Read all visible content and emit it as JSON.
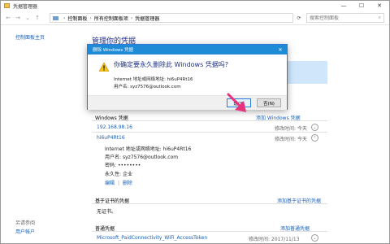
{
  "window": {
    "title": "凭据管理器",
    "controls": {
      "minimize": "—",
      "maximize": "☐",
      "close": "✕"
    }
  },
  "addressbar": {
    "breadcrumb": [
      "控制面板",
      "所有控制面板项",
      "凭据管理器"
    ],
    "search_placeholder": "搜索控制面板"
  },
  "leftnav": {
    "home": "控制面板主页",
    "see_also": "另请参阅",
    "user_accounts": "用户帐户"
  },
  "main": {
    "title": "管理你的凭据",
    "windows_credentials": {
      "title": "Windows 凭据",
      "add_link": "添加 Windows 凭据",
      "rows": [
        {
          "name": "192.168.98.16",
          "modified": "修改时间: 今天"
        },
        {
          "name": "hi6uP4Rt16",
          "modified": "修改时间: 今天"
        }
      ],
      "expanded": {
        "address_label": "Internet 地址或网络地址:",
        "address_value": "hi6uP4Rt16",
        "username_label": "用户名:",
        "username_value": "syz7576@outlook.com",
        "password_label": "密码:",
        "password_value": "••••••••",
        "persistence_label": "永久性:",
        "persistence_value": "企业",
        "edit": "编辑",
        "delete": "删除"
      }
    },
    "cert_credentials": {
      "title": "基于证书的凭据",
      "add_link": "添加基于证书的凭据",
      "empty": "无证书。"
    },
    "generic_credentials": {
      "title": "普通凭据",
      "add_link": "添加普通凭据",
      "rows": [
        {
          "name": "Microsoft_PaidConnectivity_WiFi_AccessToken",
          "modified": "修改时间: 2017/11/13"
        }
      ]
    }
  },
  "dialog": {
    "title": "删除 Windows 凭据",
    "question": "你确定要永久删除此 Windows 凭据吗?",
    "address_line": "Internet 地址或网络地址: hi6uP4Rt16",
    "username_line": "用户名: syz7576@outlook.com",
    "yes": "是(Y)",
    "no": "否(N)"
  },
  "colors": {
    "accent": "#1f8ad6",
    "link": "#1a5fb4",
    "heading": "#1e3287",
    "arrow": "#e8347e"
  }
}
